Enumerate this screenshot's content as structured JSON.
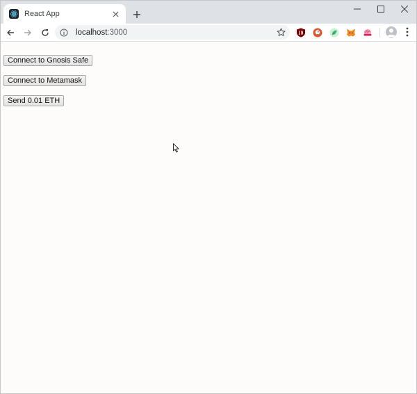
{
  "browser": {
    "tab": {
      "title": "React App",
      "favicon": "react-icon"
    },
    "new_tab_symbol": "+",
    "address_bar": {
      "host": "localhost",
      "port": ":3000"
    },
    "extensions": [
      "ublock-icon",
      "duckduckgo-icon",
      "leaf-icon",
      "metamask-icon",
      "brain-icon"
    ],
    "accent_color": "#dee1e6"
  },
  "page": {
    "buttons": {
      "connect_gnosis": "Connect to Gnosis Safe",
      "connect_metamask": "Connect to Metamask",
      "send_eth": "Send 0.01 ETH"
    }
  }
}
